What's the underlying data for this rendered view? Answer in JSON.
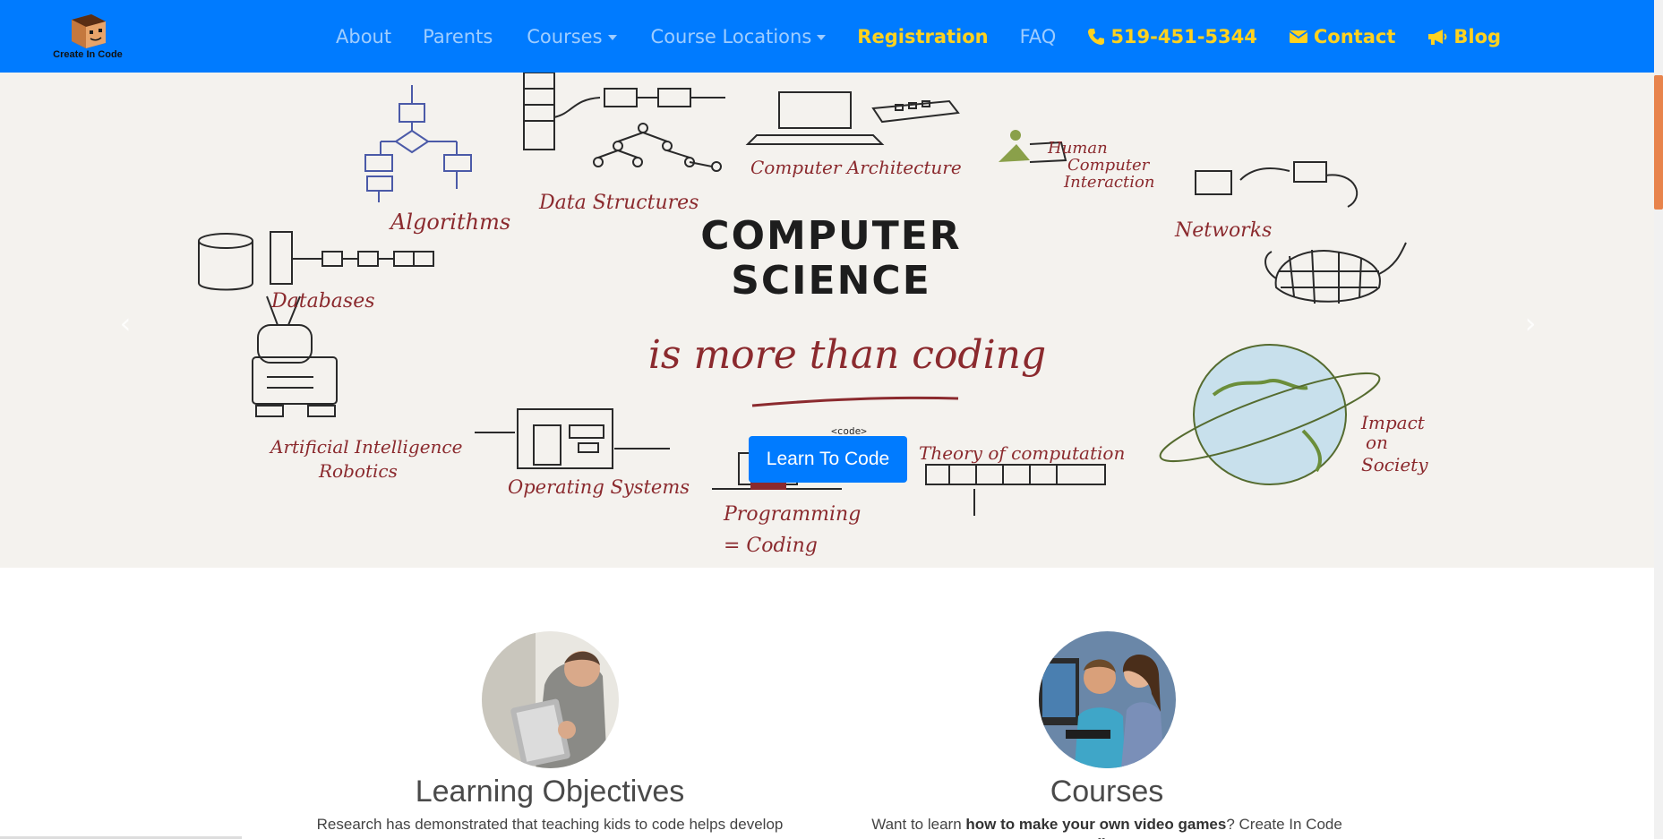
{
  "brand": {
    "name": "Create In Code"
  },
  "nav": {
    "about": "About",
    "parents": "Parents",
    "courses": "Courses",
    "locations": "Course Locations",
    "registration": "Registration",
    "faq": "FAQ",
    "phone": "519-451-5344",
    "contact": "Contact",
    "blog": "Blog"
  },
  "hero": {
    "title_line1": "COMPUTER",
    "title_line2": "SCIENCE",
    "tagline": "is more than coding",
    "code_tag": "<code>",
    "labels": {
      "algorithms": "Algorithms",
      "data_structures": "Data Structures",
      "computer_architecture": "Computer Architecture",
      "hci_1": "Human",
      "hci_2": "Computer",
      "hci_3": "Interaction",
      "networks": "Networks",
      "databases": "Databases",
      "ai_1": "Artificial Intelligence",
      "ai_2": "Robotics",
      "os": "Operating Systems",
      "programming_1": "Programming",
      "programming_2": "= Coding",
      "theory": "Theory of computation",
      "impact_1": "Impact",
      "impact_2": "on",
      "impact_3": "Society"
    },
    "cta": "Learn To Code",
    "prev": "‹",
    "next": "›"
  },
  "features": [
    {
      "title": "Learning Objectives",
      "text": "Research has demonstrated that teaching kids to code helps develop"
    },
    {
      "title": "Courses",
      "text_pre": "Want to learn ",
      "text_bold": "how to make your own video games",
      "text_post": "? Create In Code offers"
    }
  ],
  "colors": {
    "nav_bg": "#007bff",
    "highlight": "#ffd21f",
    "hand_red": "#8b2a2e"
  },
  "icons": [
    "phone-icon",
    "envelope-icon",
    "megaphone-icon",
    "caret-down-icon",
    "chevron-left-icon",
    "chevron-right-icon"
  ]
}
